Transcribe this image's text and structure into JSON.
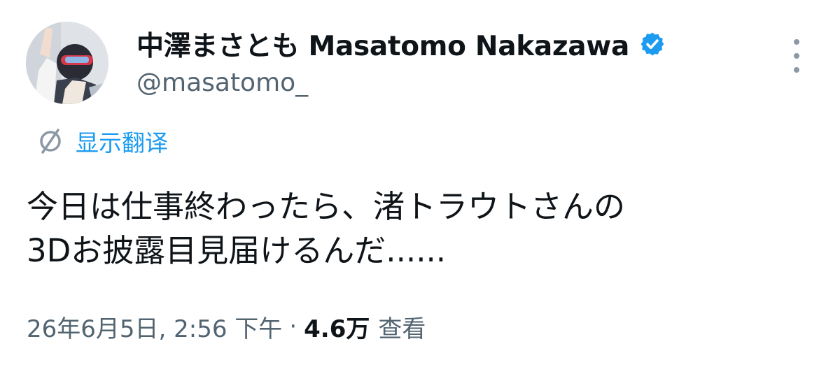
{
  "tweet": {
    "author": {
      "display_name": "中澤まさとも Masatomo Nakazawa",
      "handle": "@masatomo_",
      "verified": true
    },
    "translate_label": "显示翻译",
    "text_line1": "今日は仕事終わったら、渚トラウトさんの",
    "text_line2": "3Dお披露目見届けるんだ......",
    "timestamp": "26年6月5日, 2:56 下午",
    "separator": "·",
    "views_count": "4.6万",
    "views_label": "查看"
  },
  "icons": {
    "verified": "verified-badge-icon",
    "more": "more-vertical-icon",
    "translate": "globe-translate-icon"
  },
  "colors": {
    "accent": "#1d9bf0",
    "text_primary": "#0f1419",
    "text_secondary": "#536471"
  }
}
